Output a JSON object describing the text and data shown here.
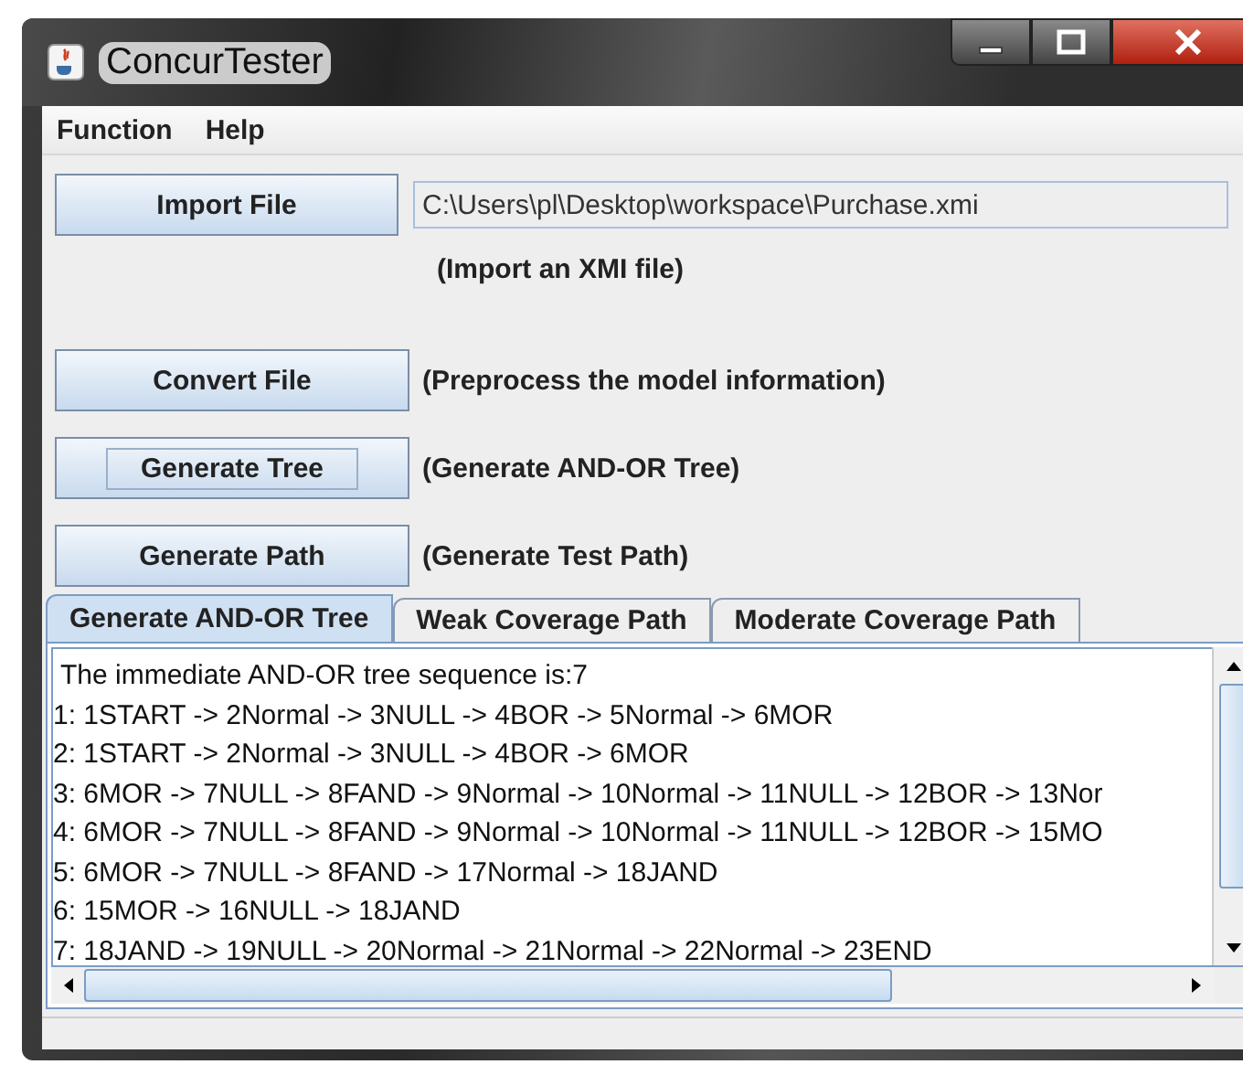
{
  "window": {
    "title": "ConcurTester"
  },
  "menu": [
    {
      "label": "Function"
    },
    {
      "label": "Help"
    }
  ],
  "actions": [
    {
      "button": "Import File",
      "focused": false,
      "field": "C:\\Users\\pl\\Desktop\\workspace\\Purchase.xmi",
      "hint": "(Import an XMI file)"
    },
    {
      "button": "Convert  File",
      "focused": false,
      "hint": "(Preprocess the model information)"
    },
    {
      "button": "Generate Tree",
      "focused": true,
      "hint": "(Generate AND-OR Tree)"
    },
    {
      "button": "Generate Path",
      "focused": false,
      "hint": "(Generate Test Path)"
    }
  ],
  "tabs": [
    {
      "label": "Generate AND-OR Tree",
      "selected": true
    },
    {
      "label": "Weak Coverage Path",
      "selected": false
    },
    {
      "label": "Moderate Coverage Path",
      "selected": false
    }
  ],
  "output_lines": [
    "The immediate AND-OR tree sequence is:7",
    "1: 1START -> 2Normal -> 3NULL -> 4BOR -> 5Normal -> 6MOR",
    "2: 1START -> 2Normal -> 3NULL -> 4BOR -> 6MOR",
    "3: 6MOR -> 7NULL -> 8FAND -> 9Normal -> 10Normal -> 11NULL -> 12BOR -> 13Nor",
    "4: 6MOR -> 7NULL -> 8FAND -> 9Normal -> 10Normal -> 11NULL -> 12BOR -> 15MO",
    "5: 6MOR -> 7NULL -> 8FAND -> 17Normal -> 18JAND",
    "6: 15MOR -> 16NULL -> 18JAND",
    "7: 18JAND -> 19NULL -> 20Normal -> 21Normal -> 22Normal -> 23END"
  ]
}
